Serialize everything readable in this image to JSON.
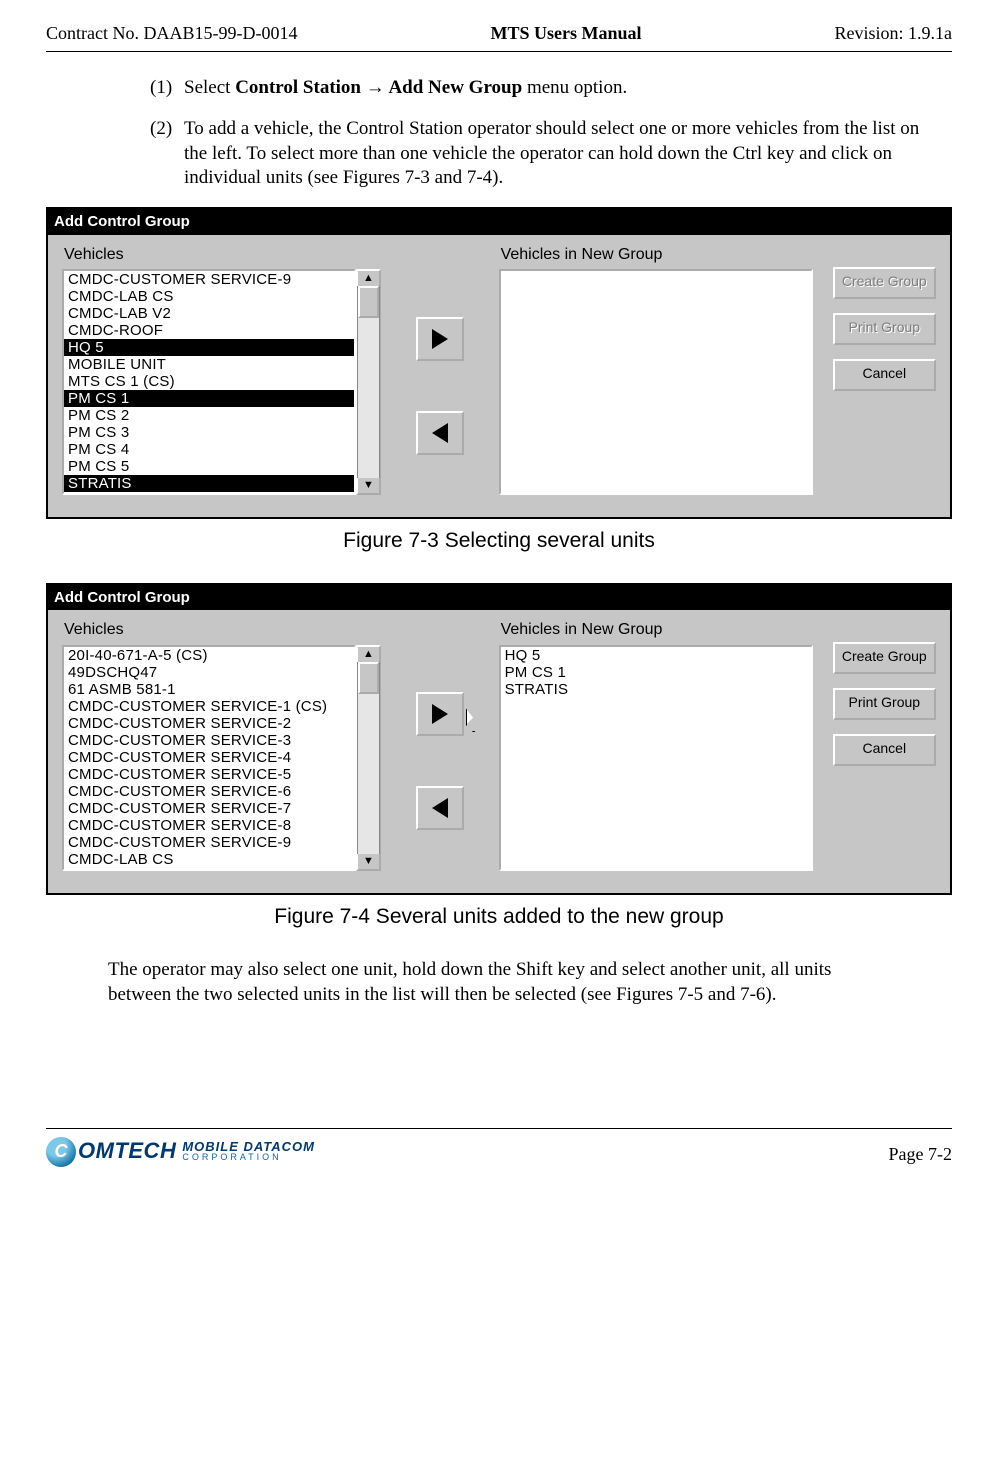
{
  "header": {
    "left": "Contract No. DAAB15-99-D-0014",
    "center": "MTS Users Manual",
    "right": "Revision:  1.9.1a"
  },
  "steps": {
    "s1": {
      "num": "(1)",
      "pre": "Select ",
      "bold": "Control Station → Add New Group",
      "post": " menu option."
    },
    "s2": {
      "num": "(2)",
      "text": "To add a vehicle, the Control Station operator should select one or more vehicles from the list on the left.  To select more than one vehicle the operator can hold down the Ctrl key and click on individual units (see Figures 7-3 and 7-4)."
    }
  },
  "dlg1": {
    "title": "Add Control Group",
    "left_label": "Vehicles",
    "right_label": "Vehicles in New Group",
    "left_items": [
      {
        "t": "CMDC-CUSTOMER SERVICE-9",
        "sel": false
      },
      {
        "t": "CMDC-LAB CS",
        "sel": false
      },
      {
        "t": "CMDC-LAB V2",
        "sel": false
      },
      {
        "t": "CMDC-ROOF",
        "sel": false
      },
      {
        "t": "HQ 5",
        "sel": true
      },
      {
        "t": "MOBILE UNIT",
        "sel": false
      },
      {
        "t": "MTS CS 1 (CS)",
        "sel": false
      },
      {
        "t": "PM CS 1",
        "sel": true
      },
      {
        "t": "PM CS 2",
        "sel": false
      },
      {
        "t": "PM CS 3",
        "sel": false
      },
      {
        "t": "PM CS 4",
        "sel": false
      },
      {
        "t": "PM CS 5",
        "sel": false
      },
      {
        "t": "STRATIS",
        "sel": true
      }
    ],
    "right_items": [],
    "buttons": {
      "create": "Create Group",
      "print": "Print Group",
      "cancel": "Cancel"
    },
    "buttons_disabled": true
  },
  "cap1": "Figure 7-3     Selecting several units",
  "dlg2": {
    "title": "Add Control Group",
    "left_label": "Vehicles",
    "right_label": "Vehicles in New Group",
    "left_items": [
      {
        "t": "20I-40-671-A-5 (CS)",
        "sel": false
      },
      {
        "t": "49DSCHQ47",
        "sel": false
      },
      {
        "t": "61 ASMB 581-1",
        "sel": false
      },
      {
        "t": "CMDC-CUSTOMER SERVICE-1 (CS)",
        "sel": false
      },
      {
        "t": "CMDC-CUSTOMER SERVICE-2",
        "sel": false
      },
      {
        "t": "CMDC-CUSTOMER SERVICE-3",
        "sel": false
      },
      {
        "t": "CMDC-CUSTOMER SERVICE-4",
        "sel": false
      },
      {
        "t": "CMDC-CUSTOMER SERVICE-5",
        "sel": false
      },
      {
        "t": "CMDC-CUSTOMER SERVICE-6",
        "sel": false
      },
      {
        "t": "CMDC-CUSTOMER SERVICE-7",
        "sel": false
      },
      {
        "t": "CMDC-CUSTOMER SERVICE-8",
        "sel": false
      },
      {
        "t": "CMDC-CUSTOMER SERVICE-9",
        "sel": false
      },
      {
        "t": "CMDC-LAB CS",
        "sel": false
      }
    ],
    "right_items": [
      {
        "t": "HQ 5",
        "sel": false
      },
      {
        "t": "PM CS 1",
        "sel": false
      },
      {
        "t": "STRATIS",
        "sel": false
      }
    ],
    "buttons": {
      "create": "Create Group",
      "print": "Print Group",
      "cancel": "Cancel"
    },
    "buttons_disabled": false
  },
  "cap2": "Figure 7-4     Several units added to the new group",
  "para": "The operator may also select one unit, hold down the Shift key and select another unit, all units between the two selected units in the list will then be selected (see Figures 7-5 and 7-6).",
  "footer": {
    "logo_c": "C",
    "logo_omtech": "OMTECH",
    "logo_l1": "MOBILE DATACOM",
    "logo_l2": "CORPORATION",
    "page": "Page 7-2"
  }
}
